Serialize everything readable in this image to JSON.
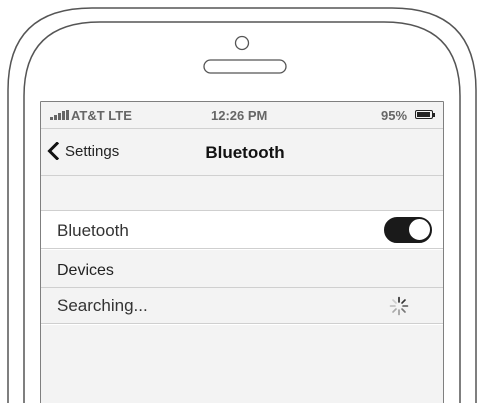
{
  "status_bar": {
    "carrier": "AT&T LTE",
    "time": "12:26 PM",
    "battery_percent": "95%",
    "battery_level": 0.95
  },
  "nav_bar": {
    "back_label": "Settings",
    "title": "Bluetooth"
  },
  "bluetooth_row": {
    "label": "Bluetooth",
    "toggle_on": true
  },
  "devices_section": {
    "header": "Devices",
    "status": "Searching..."
  },
  "icons": {
    "back": "chevron-left-icon",
    "signal": "signal-bars-icon",
    "battery": "battery-icon",
    "spinner": "loading-spinner-icon",
    "camera": "front-camera-icon",
    "speaker": "speaker-grille-icon"
  }
}
